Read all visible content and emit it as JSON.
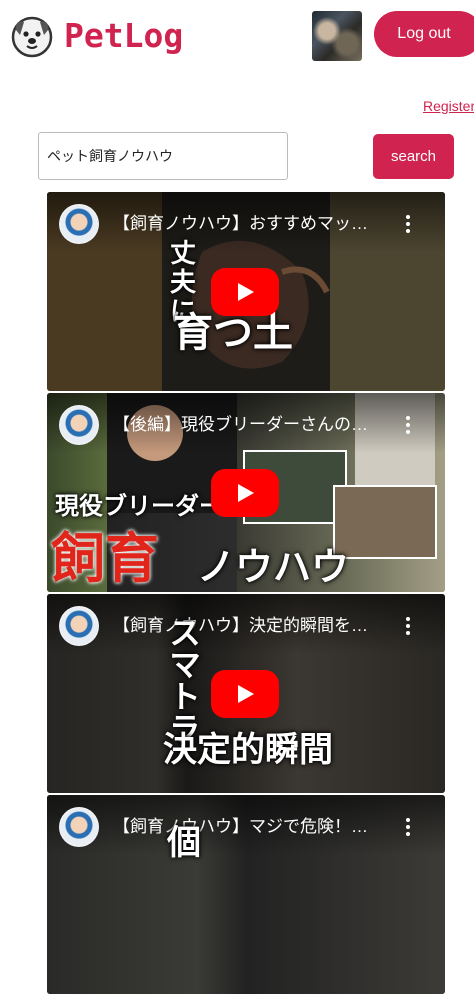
{
  "header": {
    "app_name": "PetLog",
    "logout_label": "Log out"
  },
  "register_label": "Register",
  "search": {
    "value": "ペット飼育ノウハウ",
    "button_label": "search"
  },
  "videos": [
    {
      "title": "【飼育ノウハウ】おすすめマッ…",
      "overlay": [
        "丈",
        "夫",
        "に",
        "育つ土"
      ]
    },
    {
      "title": "【後編】現役ブリーダーさんの…",
      "overlay": [
        "現役ブリーダー",
        "飼育",
        "ノウハウ"
      ]
    },
    {
      "title": "【飼育ノウハウ】決定的瞬間を…",
      "overlay": [
        "スマトラ",
        "決定的瞬間"
      ]
    },
    {
      "title": "【飼育ノウハウ】マジで危険！…",
      "overlay": [
        "個"
      ]
    }
  ],
  "colors": {
    "accent": "#d0234f",
    "play_button": "#ff0000"
  },
  "icons": {
    "logo": "dog-face-icon",
    "video_menu": "more-vertical-icon",
    "play": "play-icon"
  }
}
